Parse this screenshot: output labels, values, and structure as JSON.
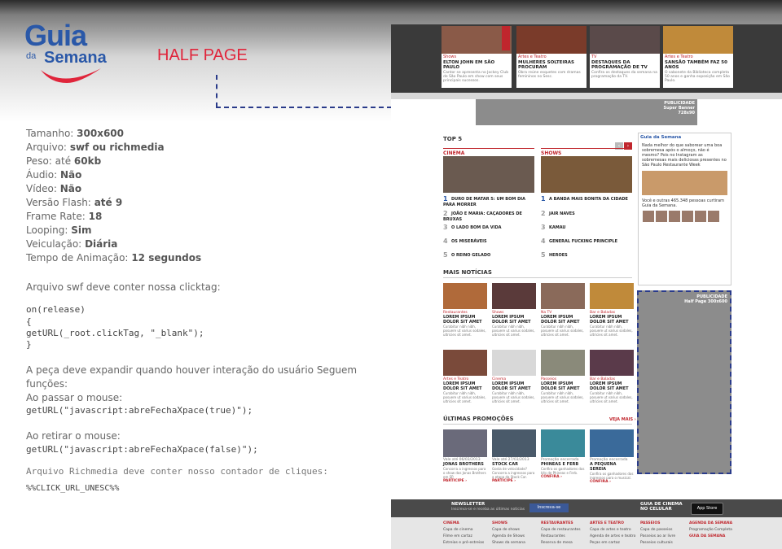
{
  "header": {
    "logo_line1": "Guia",
    "logo_line2": "da",
    "logo_line3": "Semana",
    "title": "HALF PAGE"
  },
  "specs": [
    {
      "label": "Tamanho:",
      "value": "300x600"
    },
    {
      "label": "Arquivo:",
      "value": "swf ou richmedia"
    },
    {
      "label": "Peso: até",
      "value": "60kb"
    },
    {
      "label": "Áudio:",
      "value": "Não"
    },
    {
      "label": "Vídeo:",
      "value": "Não"
    },
    {
      "label": "Versão Flash:",
      "value": "até 9"
    },
    {
      "label": "Frame Rate:",
      "value": "18"
    },
    {
      "label": "Looping:",
      "value": "Sim"
    },
    {
      "label": "Veiculação:",
      "value": "Diária"
    },
    {
      "label": "Tempo de Animação:",
      "value": "12 segundos"
    }
  ],
  "clicktag": {
    "intro": "Arquivo swf deve conter nossa clicktag:",
    "code": [
      "on(release)",
      "{",
      "getURL(_root.clickTag, \"_blank\");",
      "}"
    ]
  },
  "expand": {
    "line1": "A peça deve expandir quando houver interação do usuário Seguem",
    "line2": "funções:",
    "line3": "Ao passar o mouse:",
    "code1": "getURL(\"javascript:abreFechaXpace(true)\");",
    "line4": "Ao retirar o mouse:",
    "code2": "getURL(\"javascript:abreFechaXpace(false)\");"
  },
  "richmedia": {
    "line": "Arquivo Richmedia deve conter nosso contador de cliques:",
    "code": "%%CLICK_URL_UNESC%%"
  },
  "mockup": {
    "top_cards": [
      {
        "cat": "Shows",
        "head": "ELTON JOHN EM SÃO PAULO",
        "body": "Cantor se apresenta no Jockey Club de São Paulo em show com seus principais sucessos."
      },
      {
        "cat": "Artes e Teatro",
        "head": "MULHERES SOLTEIRAS PROCURAM",
        "body": "Obra reúne esquetes com dramas femininos no Sesc."
      },
      {
        "cat": "TV",
        "head": "DESTAQUES DA PROGRAMAÇÃO DE TV",
        "body": "Confira os destaques da semana na programação da TV."
      },
      {
        "cat": "Artes e Teatro",
        "head": "SANSÃO TAMBÉM FAZ 50 ANOS",
        "body": "O sabonete da Biblioteca completa 50 anos e ganha exposição em São Paulo."
      }
    ],
    "pub_super": "PUBLICIDADE\nSuper Banner\n728x90",
    "top5": "TOP 5",
    "col_cinema": "CINEMA",
    "col_shows": "SHOWS",
    "cinema_rank": [
      "DURO DE MATAR 5: UM BOM DIA PARA MORRER",
      "JOÃO E MARIA: CAÇADORES DE BRUXAS",
      "O LADO BOM DA VIDA",
      "OS MISERÁVEIS",
      "O REINO GELADO"
    ],
    "shows_rank": [
      "A BANDA MAIS BONITA DA CIDADE",
      "JAIR NAVES",
      "KAMAU",
      "GENERAL FUCKING PRINCIPLE",
      "HEROES"
    ],
    "fb_title": "Guia da Semana",
    "fb_post": "Nada melhor do que saborear uma boa sobremesa após o almoço, não é mesmo? Pois no Instagram as sobremesas mais deliciosas presentes no São Paulo Restaurante Week",
    "fb_footer": "Você e outras 465.348 pessoas curtiram Guia da Semana.",
    "mais_noticias": "MAIS NOTÍCIAS",
    "news_cards": [
      {
        "cat": "Restaurantes",
        "head": "LOREM IPSUM DOLOR SIT AMET",
        "body": "Curabitur nibh nibh, posuere ut varius sodales, ultricies sit amet."
      },
      {
        "cat": "Shows",
        "head": "LOREM IPSUM DOLOR SIT AMET",
        "body": "Curabitur nibh nibh, posuere ut varius sodales, ultricies sit amet."
      },
      {
        "cat": "Na TV",
        "head": "LOREM IPSUM DOLOR SIT AMET",
        "body": "Curabitur nibh nibh, posuere ut varius sodales, ultricies sit amet."
      },
      {
        "cat": "Bar e Baladas",
        "head": "LOREM IPSUM DOLOR SIT AMET",
        "body": "Curabitur nibh nibh, posuere ut varius sodales, ultricies sit amet."
      },
      {
        "cat": "Artes e Teatro",
        "head": "LOREM IPSUM DOLOR SIT AMET",
        "body": "Curabitur nibh nibh, posuere ut varius sodales, ultricies sit amet."
      },
      {
        "cat": "Cinema",
        "head": "LOREM IPSUM DOLOR SIT AMET",
        "body": "Curabitur nibh nibh, posuere ut varius sodales, ultricies sit amet."
      },
      {
        "cat": "Passeios",
        "head": "LOREM IPSUM DOLOR SIT AMET",
        "body": "Curabitur nibh nibh, posuere ut varius sodales, ultricies sit amet."
      },
      {
        "cat": "Bar e Baladas",
        "head": "LOREM IPSUM DOLOR SIT AMET",
        "body": "Curabitur nibh nibh, posuere ut varius sodales, ultricies sit amet."
      }
    ],
    "ultimas_promocoes": "ÚLTIMAS PROMOÇÕES",
    "veja_mais": "VEJA MAIS ›",
    "promo_cards": [
      {
        "date": "Vale até 06/03/2013",
        "head": "JONAS BROTHERS",
        "body": "Concorra a ingressos para o show dos Jonas Brothers em SP.",
        "cta": "PARTICIPE ›"
      },
      {
        "date": "Vale até 27/03/2013",
        "head": "STOCK CAR",
        "body": "Gosta de velocidade? Concorra a ingressos para a etapa da Stock Car.",
        "cta": "PARTICIPE ›"
      },
      {
        "date": "Promoção encerrada",
        "head": "PHINEAS E FERB",
        "body": "Confira os ganhadores dos kits de Phineas e Ferb.",
        "cta": "CONFIRA ›"
      },
      {
        "date": "Promoção encerrada",
        "head": "A PEQUENA SEREIA",
        "body": "Confira os ganhadores dos ingressos para o musical.",
        "cta": "CONFIRA ›"
      }
    ],
    "half_page_label": "PUBLICIDADE\nHalf Page 300x600",
    "newsletter_title": "NEWSLETTER",
    "newsletter_sub": "Inscreva-se e receba as últimas notícias",
    "facebook_btn": "Inscreva-se",
    "guia_celular": "GUIA DE CINEMA\nNO CELULAR",
    "appstore": "App Store",
    "footer_cols": [
      {
        "head": "CINEMA",
        "items": [
          "Capa de cinema",
          "Filme em cartaz",
          "Estreias e pré-estreias"
        ]
      },
      {
        "head": "SHOWS",
        "items": [
          "Capa de shows",
          "Agenda de Shows",
          "Shows da semana"
        ]
      },
      {
        "head": "RESTAURANTES",
        "items": [
          "Capa de restaurantes",
          "Restaurantes",
          "Reserva de mesa"
        ]
      },
      {
        "head": "ARTES E TEATRO",
        "items": [
          "Capa de artes e teatro",
          "Agenda de artes e teatro",
          "Peças em cartaz"
        ]
      },
      {
        "head": "PASSEIOS",
        "items": [
          "Capa de passeios",
          "Passeios ao ar livre",
          "Passeios culturais"
        ]
      },
      {
        "head": "AGENDA DA SEMANA",
        "items": [
          "Programação Completa",
          "",
          "GUIA DA SEMANA"
        ]
      }
    ]
  },
  "colors": {
    "brand_red": "#e0253b",
    "brand_blue": "#2a58a8",
    "dash_line": "#2a3b8a"
  }
}
